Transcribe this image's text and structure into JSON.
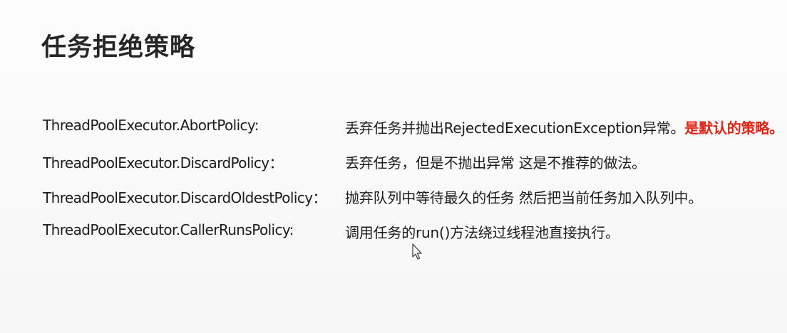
{
  "slide": {
    "title": "任务拒绝策略",
    "policies": [
      {
        "name": "ThreadPoolExecutor.AbortPolicy:",
        "description": "丢弃任务并抛出RejectedExecutionException异常。",
        "highlight": "是默认的策略。"
      },
      {
        "name": "ThreadPoolExecutor.DiscardPolicy：",
        "description": "丢弃任务，但是不抛出异常 这是不推荐的做法。",
        "highlight": ""
      },
      {
        "name": "ThreadPoolExecutor.DiscardOldestPolicy：",
        "description": "抛弃队列中等待最久的任务 然后把当前任务加入队列中。",
        "highlight": ""
      },
      {
        "name": "ThreadPoolExecutor.CallerRunsPolicy:",
        "description": "调用任务的run()方法绕过线程池直接执行。",
        "highlight": ""
      }
    ]
  },
  "colors": {
    "highlight": "#e02416",
    "text": "#1c1c1c",
    "background": "#fbfbfb"
  },
  "icons": {
    "cursor": "mouse-pointer-icon"
  }
}
